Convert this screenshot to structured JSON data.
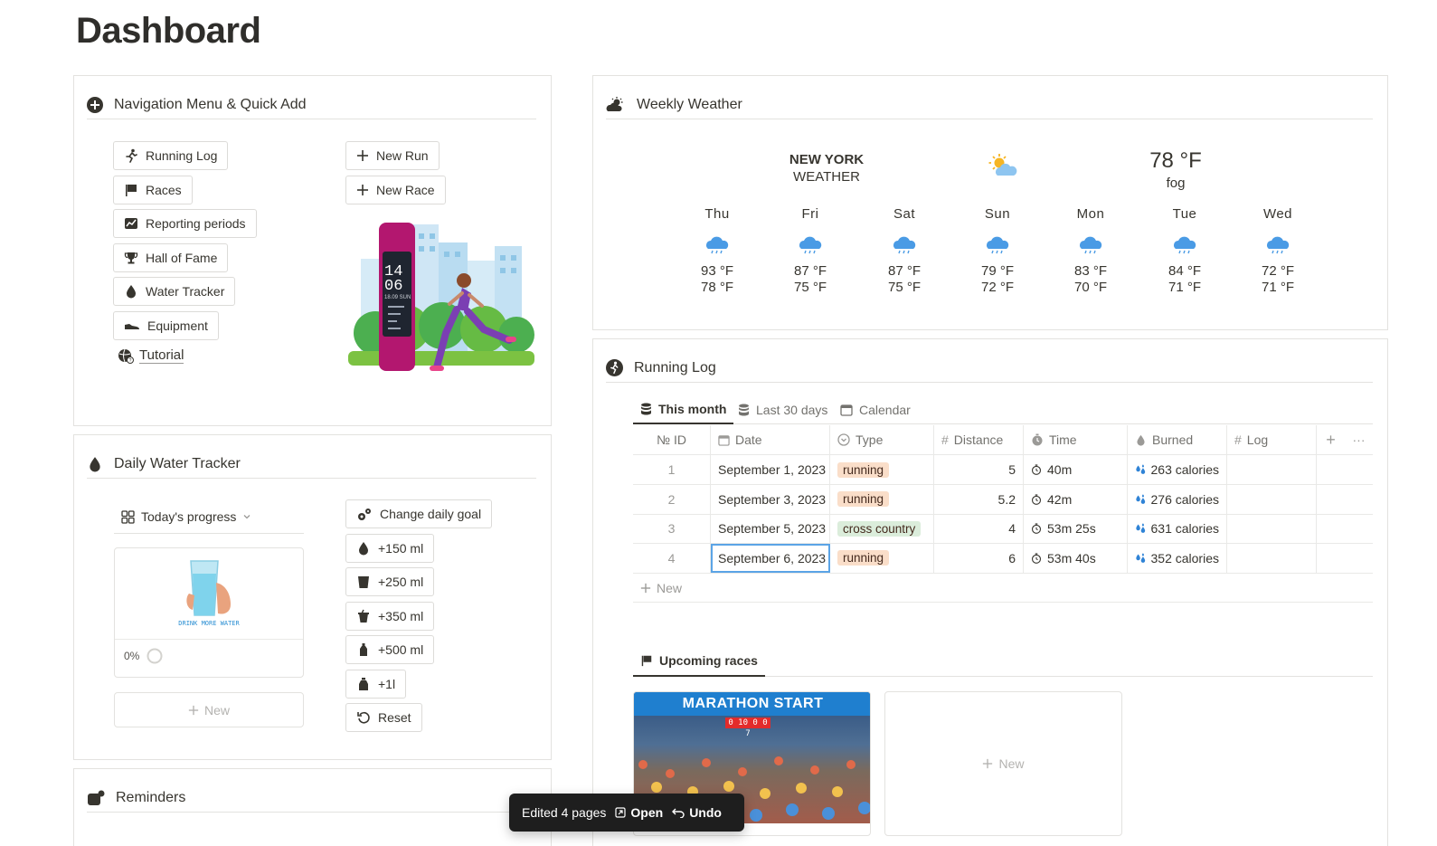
{
  "page": {
    "title": "Dashboard"
  },
  "nav_panel": {
    "title": "Navigation Menu & Quick Add",
    "links": [
      {
        "label": "Running Log",
        "icon": "running-icon"
      },
      {
        "label": "Races",
        "icon": "flag-icon"
      },
      {
        "label": "Reporting periods",
        "icon": "chart-icon"
      },
      {
        "label": "Hall of Fame",
        "icon": "trophy-icon"
      },
      {
        "label": "Water Tracker",
        "icon": "drop-icon"
      },
      {
        "label": "Equipment",
        "icon": "shoe-icon"
      }
    ],
    "tutorial": "Tutorial",
    "quick_add": [
      {
        "label": "New Run",
        "icon": "plus-icon"
      },
      {
        "label": "New Race",
        "icon": "plus-icon"
      }
    ],
    "watch": {
      "hour": "14",
      "minute": "06",
      "date": "18.09 SUN"
    }
  },
  "water_panel": {
    "title": "Daily Water Tracker",
    "view_label": "Today's progress",
    "card_caption": "DRINK MORE WATER",
    "progress": "0%",
    "new_label": "New",
    "buttons": [
      {
        "label": "Change daily goal",
        "icon": "gears-icon"
      },
      {
        "label": "+150 ml",
        "icon": "drop-icon"
      },
      {
        "label": "+250 ml",
        "icon": "glass-icon"
      },
      {
        "label": "+350 ml",
        "icon": "cup-icon"
      },
      {
        "label": "+500 ml",
        "icon": "bottle-icon"
      },
      {
        "label": "+1l",
        "icon": "jug-icon"
      },
      {
        "label": "Reset",
        "icon": "reset-icon"
      }
    ]
  },
  "reminders_panel": {
    "title": "Reminders"
  },
  "weather_panel": {
    "title": "Weekly Weather",
    "city_line1": "NEW YORK",
    "city_line2": "WEATHER",
    "current_temp": "78 °F",
    "current_desc": "fog",
    "days": [
      {
        "name": "Thu",
        "hi": "93 °F",
        "lo": "78 °F",
        "icon": "rain-cloud-icon"
      },
      {
        "name": "Fri",
        "hi": "87 °F",
        "lo": "75 °F",
        "icon": "rain-cloud-icon"
      },
      {
        "name": "Sat",
        "hi": "87 °F",
        "lo": "75 °F",
        "icon": "rain-cloud-icon"
      },
      {
        "name": "Sun",
        "hi": "79 °F",
        "lo": "72 °F",
        "icon": "rain-cloud-icon"
      },
      {
        "name": "Mon",
        "hi": "83 °F",
        "lo": "70 °F",
        "icon": "rain-cloud-icon"
      },
      {
        "name": "Tue",
        "hi": "84 °F",
        "lo": "71 °F",
        "icon": "rain-cloud-icon"
      },
      {
        "name": "Wed",
        "hi": "72 °F",
        "lo": "71 °F",
        "icon": "rain-cloud-icon"
      }
    ]
  },
  "running_log": {
    "title": "Running Log",
    "tabs": [
      "This month",
      "Last 30 days",
      "Calendar"
    ],
    "columns": [
      "№ ID",
      "Date",
      "Type",
      "Distance",
      "Time",
      "Burned",
      "Log"
    ],
    "rows": [
      {
        "id": "1",
        "date": "September 1, 2023",
        "type": "running",
        "distance": "5",
        "time": "40m",
        "burned": "263 calories"
      },
      {
        "id": "2",
        "date": "September 3, 2023",
        "type": "running",
        "distance": "5.2",
        "time": "42m",
        "burned": "276 calories"
      },
      {
        "id": "3",
        "date": "September 5, 2023",
        "type": "cross country",
        "distance": "4",
        "time": "53m 25s",
        "burned": "631 calories"
      },
      {
        "id": "4",
        "date": "September 6, 2023",
        "type": "running",
        "distance": "6",
        "time": "53m 40s",
        "burned": "352 calories"
      }
    ],
    "new_label": "New",
    "colors": {
      "running": "#fadec9",
      "cross country": "#dbeddb"
    }
  },
  "races": {
    "tab": "Upcoming races",
    "card_banner": "MARATHON START",
    "card_clock": "0 10 0 0 7",
    "new_label": "New"
  },
  "toast": {
    "message": "Edited 4 pages",
    "open": "Open",
    "undo": "Undo"
  }
}
